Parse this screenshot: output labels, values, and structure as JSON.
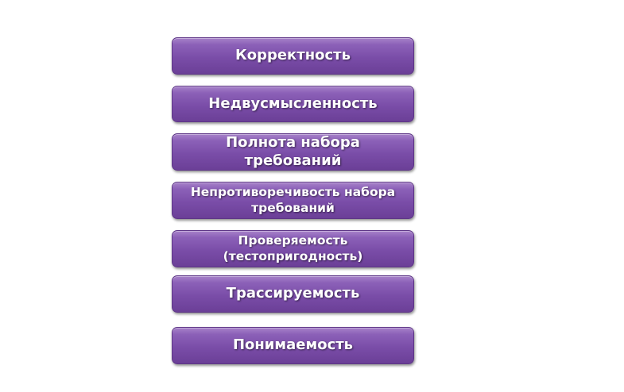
{
  "diagram": {
    "items": [
      {
        "label": "Корректность"
      },
      {
        "label": "Недвусмысленность"
      },
      {
        "label": "Полнота набора требований"
      },
      {
        "label": "Непротиворечивость набора требований"
      },
      {
        "label": "Проверяемость (тестопригодность)"
      },
      {
        "label": "Трассируемость"
      },
      {
        "label": "Понимаемость"
      }
    ],
    "box_color": "#7a4da8",
    "text_color": "#ffffff"
  }
}
